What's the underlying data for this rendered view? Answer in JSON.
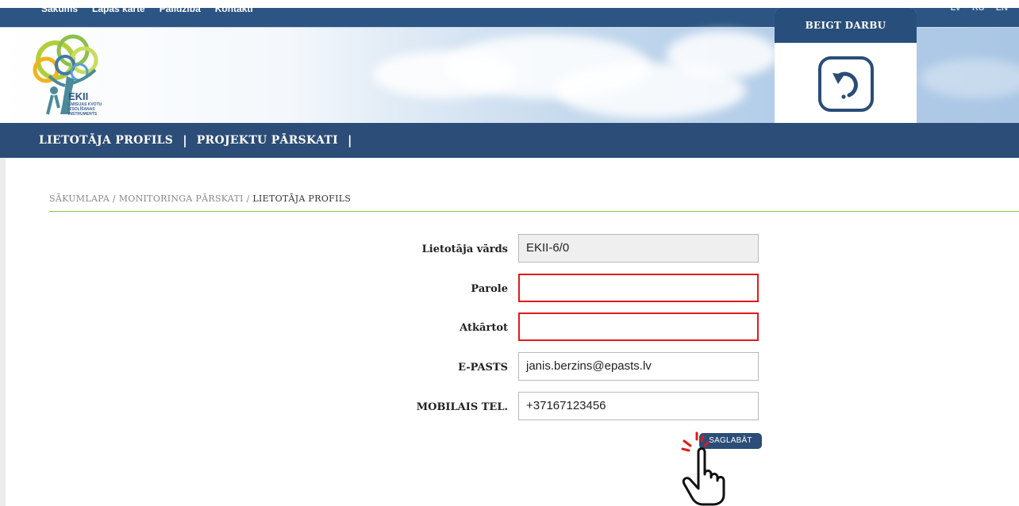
{
  "topnav": {
    "items": [
      "Sākums",
      "Lapas karte",
      "Palīdzība",
      "Kontakti"
    ]
  },
  "langs": [
    "LV",
    "RU",
    "EN"
  ],
  "logo": {
    "title": "EKII",
    "subtitle_lines": [
      "EMISIJAS KVOTU",
      "IZSOLĪŠANAS",
      "INSTRUMENTS"
    ]
  },
  "logout": {
    "label": "BEIGT DARBU",
    "icon": "undo-icon"
  },
  "mainnav": {
    "items": [
      "LIETOTĀJA PROFILS",
      "PROJEKTU PĀRSKATI"
    ],
    "separator": "|"
  },
  "breadcrumb": {
    "items": [
      "SĀKUMLAPA",
      "MONITORINGA PĀRSKATI"
    ],
    "separator": "/",
    "current": "LIETOTĀJA PROFILS"
  },
  "form": {
    "username": {
      "label": "Lietotāja vārds",
      "value": "EKII-6/0"
    },
    "password": {
      "label": "Parole",
      "value": ""
    },
    "repeat": {
      "label": "Atkārtot",
      "value": ""
    },
    "email": {
      "label": "E-PASTS",
      "value": "janis.berzins@epasts.lv"
    },
    "mobile": {
      "label": "MOBILAIS TEL.",
      "value": "+37167123456"
    },
    "save_label": "SAGLABĀT"
  },
  "colors": {
    "nav_blue": "#2b4d77",
    "error_red": "#e01b1b",
    "accent_green": "#8dc63f"
  }
}
